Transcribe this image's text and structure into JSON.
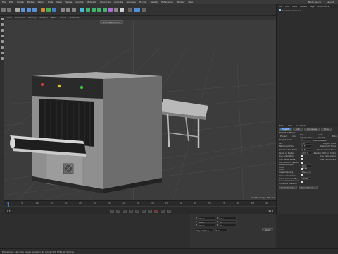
{
  "menu": {
    "items": [
      "File",
      "Edit",
      "Create",
      "Modes",
      "Select",
      "Tools",
      "Mesh",
      "Spline",
      "Volume",
      "MoGraph",
      "Character",
      "Animate",
      "Simulate",
      "Tracker",
      "Render",
      "Extensions",
      "Window",
      "Help"
    ],
    "right": [
      "Node Space",
      "Layout"
    ]
  },
  "objects_panel": {
    "tabs": [
      "File",
      "Edit",
      "View",
      "Object",
      "Tags",
      "Bookmarks"
    ],
    "item_name": "Standard Camera"
  },
  "viewport": {
    "menu": [
      "View",
      "Cameras",
      "Display",
      "Options",
      "Filter",
      "Panel",
      "ProRender"
    ],
    "camera_label": "Default Camera",
    "grid_spacing": "Grid Spacing : 100 cm",
    "axis_label": "Perspective"
  },
  "attributes": {
    "menu": [
      "Mode",
      "Edit",
      "User Data"
    ],
    "tabs": [
      "Project",
      "Info",
      "Cineware",
      "Todo"
    ],
    "section_title": "Project Settings",
    "tabs2": [
      "Project",
      "Info",
      "Animation",
      "Referencing"
    ],
    "subtabs": [
      "Project",
      "Info",
      "Key Interpolation",
      "Scale Project...",
      "Todo"
    ],
    "rows": [
      {
        "label": "Project Scale",
        "value": "1",
        "unit": "Centimeters"
      },
      {
        "label": "FPS",
        "value": "30",
        "right": "Project Time"
      },
      {
        "label": "Minimum Time",
        "value": "0 F",
        "right": "Maximum Time"
      },
      {
        "label": "Preview Min Time",
        "value": "0 F",
        "right": "Preview Max Time"
      },
      {
        "label": "Level of Detail",
        "value": "100 %",
        "right": "Render LOD in Editor"
      },
      {
        "label": "Use Animation",
        "right": "Use Expression"
      },
      {
        "label": "Use Generators",
        "right": "Use Deformers"
      },
      {
        "label": "Use Motion System"
      },
      {
        "label": "Default Object Color",
        "value": "60% Gray"
      },
      {
        "label": "Color"
      },
      {
        "label": "View Clipping",
        "value": "Medium"
      },
      {
        "label": "Linear Workflow"
      },
      {
        "label": "Input Color Profile",
        "value": "sRGB"
      },
      {
        "label": "Use Color Channel for Node Material"
      }
    ],
    "buttons": [
      "Load Preset...",
      "Save Preset..."
    ]
  },
  "timeline": {
    "ticks": [
      "0",
      "5",
      "10",
      "15",
      "20",
      "25",
      "30",
      "35",
      "40",
      "45",
      "50",
      "55",
      "60",
      "65",
      "70",
      "75",
      "80",
      "85",
      "90"
    ],
    "frame": "0 F",
    "end": "90 F"
  },
  "coords": {
    "labels": [
      "X",
      "Y",
      "Z"
    ],
    "values": [
      "0 cm",
      "0 cm",
      "0 cm"
    ],
    "rot_labels": [
      "H",
      "P",
      "B"
    ],
    "rot_values": [
      "0 °",
      "0 °",
      "0 °"
    ],
    "apply_label": "Apply",
    "mode": "Object (Rel)",
    "size_mode": "Size"
  },
  "status": "Movement: Left click to set selection, to move click CTRL to remove",
  "colors": {
    "light_red": "#d33b2f",
    "light_yellow": "#d8c22a",
    "light_green": "#3fc33c",
    "machine_body": "#9a9a9a",
    "accent_blue": "#3b78c4"
  }
}
